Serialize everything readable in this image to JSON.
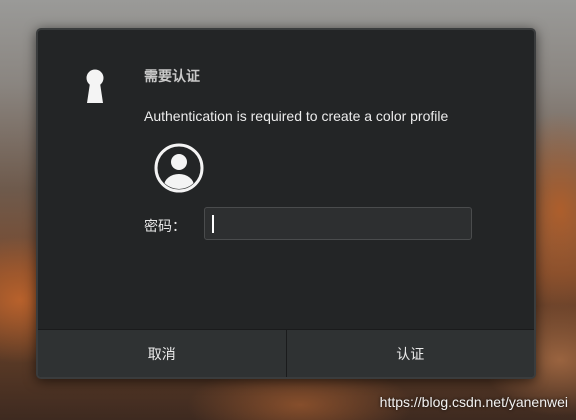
{
  "dialog": {
    "title": "需要认证",
    "message": "Authentication is required to create a color profile",
    "password_label": "密码：",
    "password_value": "",
    "cancel_label": "取消",
    "confirm_label": "认证",
    "lock_icon": "keyhole-lock-icon",
    "avatar_icon": "user-avatar-icon"
  },
  "watermark": "https://blog.csdn.net/yanenwei",
  "colors": {
    "dialog_bg": "#232526",
    "button_bg": "#2f3233",
    "text": "#ececec"
  }
}
